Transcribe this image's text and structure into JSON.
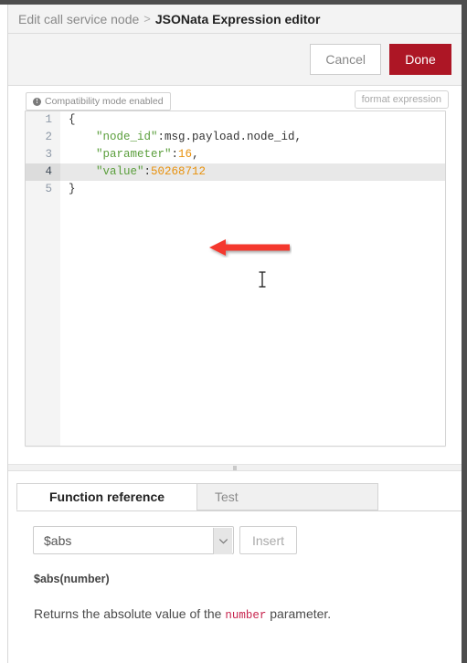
{
  "window": {
    "breadcrumb_parent": "Edit call service node",
    "breadcrumb_separator": ">",
    "breadcrumb_current": "JSONata Expression editor"
  },
  "actions": {
    "cancel_label": "Cancel",
    "done_label": "Done",
    "done_color": "#ad1625"
  },
  "editor_toolbar": {
    "compatibility_badge": "Compatibility mode enabled",
    "compatibility_icon": "info-icon",
    "format_expression_label": "format expression"
  },
  "editor": {
    "active_line": 4,
    "gutter": [
      "1",
      "2",
      "3",
      "4",
      "5"
    ],
    "lines": [
      {
        "number": "1",
        "segments": [
          {
            "text": "{",
            "type": "punct"
          }
        ]
      },
      {
        "number": "2",
        "segments": [
          {
            "text": "    ",
            "type": "punct"
          },
          {
            "text": "\"node_id\"",
            "type": "string"
          },
          {
            "text": ":msg.payload.node_id,",
            "type": "punct"
          }
        ]
      },
      {
        "number": "3",
        "segments": [
          {
            "text": "    ",
            "type": "punct"
          },
          {
            "text": "\"parameter\"",
            "type": "string"
          },
          {
            "text": ":",
            "type": "punct"
          },
          {
            "text": "16",
            "type": "num"
          },
          {
            "text": ",",
            "type": "punct"
          }
        ]
      },
      {
        "number": "4",
        "segments": [
          {
            "text": "    ",
            "type": "punct"
          },
          {
            "text": "\"value\"",
            "type": "string"
          },
          {
            "text": ":",
            "type": "punct"
          },
          {
            "text": "50268712",
            "type": "num"
          }
        ]
      },
      {
        "number": "5",
        "segments": [
          {
            "text": "}",
            "type": "punct"
          }
        ]
      }
    ],
    "plain_text": "{\n    \"node_id\":msg.payload.node_id,\n    \"parameter\":16,\n    \"value\":50268712\n}"
  },
  "annotation": {
    "type": "arrow",
    "direction": "left",
    "color": "#f4392e",
    "target_line": 3
  },
  "bottom_panel": {
    "tabs": [
      {
        "label": "Function reference",
        "active": true
      },
      {
        "label": "Test",
        "active": false
      }
    ],
    "function_select_value": "$abs",
    "insert_label": "Insert",
    "signature": "$abs(number)",
    "description_prefix": "Returns the absolute value of the ",
    "description_code": "number",
    "description_suffix": " parameter."
  }
}
